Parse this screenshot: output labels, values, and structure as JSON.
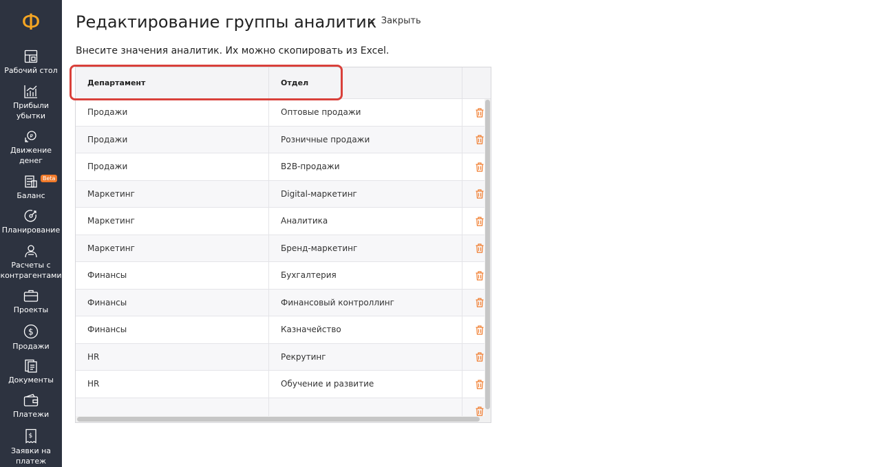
{
  "app": {
    "logo": "Ф"
  },
  "sidebar": {
    "items": [
      {
        "label": "Рабочий стол",
        "icon": "desktop-icon"
      },
      {
        "label": "Прибыли убытки",
        "icon": "chart-icon"
      },
      {
        "label": "Движение денег",
        "icon": "money-flow-icon"
      },
      {
        "label": "Баланс",
        "icon": "balance-icon",
        "badge": "Beta"
      },
      {
        "label": "Планирование",
        "icon": "planning-icon"
      },
      {
        "label": "Расчеты с контрагентами",
        "icon": "contractors-icon"
      },
      {
        "label": "Проекты",
        "icon": "briefcase-icon"
      },
      {
        "label": "Продажи",
        "icon": "dollar-icon"
      },
      {
        "label": "Документы",
        "icon": "documents-icon"
      },
      {
        "label": "Платежи",
        "icon": "wallet-icon"
      },
      {
        "label": "Заявки на платеж",
        "icon": "payment-request-icon"
      }
    ]
  },
  "header": {
    "title": "Редактирование группы аналитик",
    "close_symbol": "×",
    "close_label": "Закрыть"
  },
  "subtitle": "Внесите значения аналитик. Их можно скопировать из Excel.",
  "table": {
    "columns": [
      "Департамент",
      "Отдел"
    ],
    "rows": [
      [
        "Продажи",
        "Оптовые продажи"
      ],
      [
        "Продажи",
        "Розничные продажи"
      ],
      [
        "Продажи",
        "B2B-продажи"
      ],
      [
        "Маркетинг",
        "Digital-маркетинг"
      ],
      [
        "Маркетинг",
        "Аналитика"
      ],
      [
        "Маркетинг",
        "Бренд-маркетинг"
      ],
      [
        "Финансы",
        "Бухгалтерия"
      ],
      [
        "Финансы",
        "Финансовый контроллинг"
      ],
      [
        "Финансы",
        "Казначейство"
      ],
      [
        "HR",
        "Рекрутинг"
      ],
      [
        "HR",
        "Обучение и развитие"
      ],
      [
        "",
        ""
      ]
    ]
  },
  "colors": {
    "sidebar_bg": "#2d3340",
    "logo": "#f5a623",
    "delete_icon": "#f07a2a",
    "highlight": "#d9403a"
  }
}
